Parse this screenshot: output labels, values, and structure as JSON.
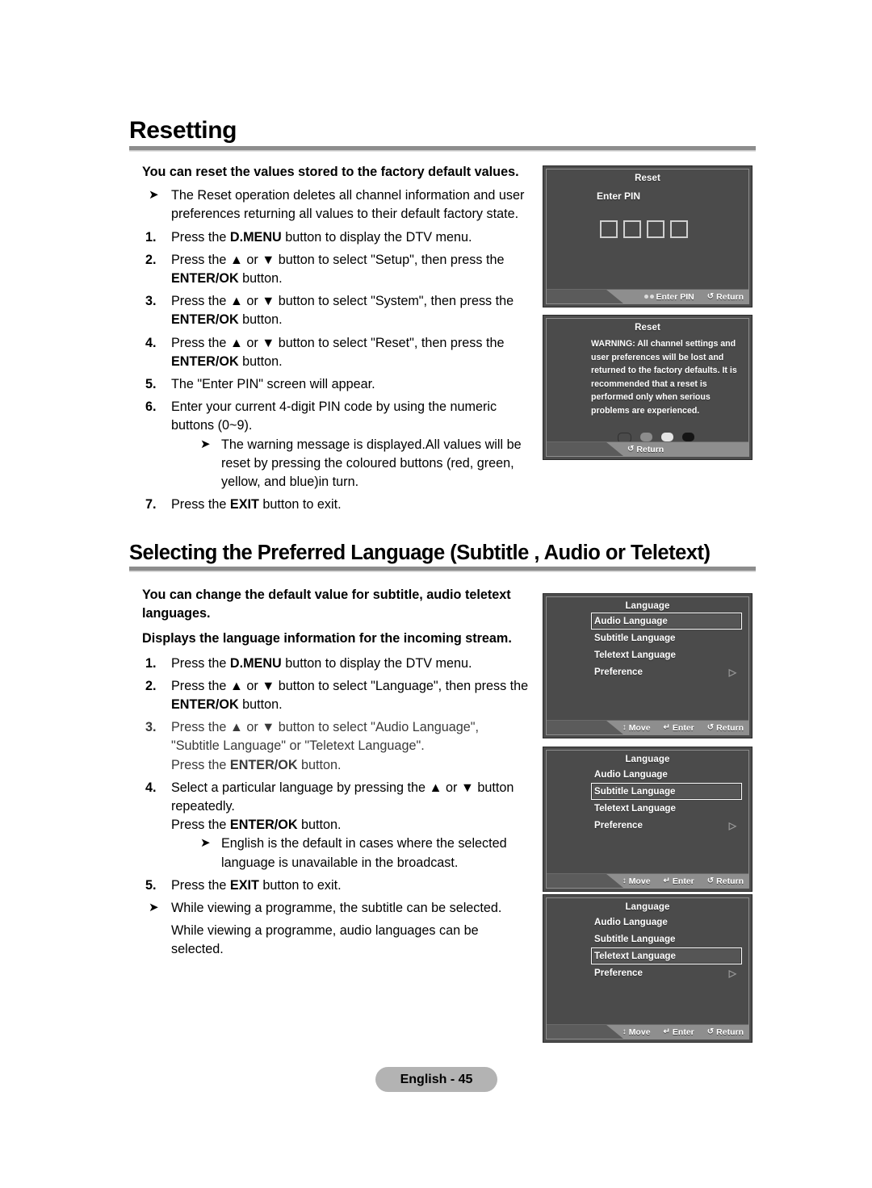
{
  "page": {
    "footer_label": "English - 45"
  },
  "sections": [
    {
      "heading": "Resetting",
      "lead": "You can reset the values stored to the factory default values.",
      "note_top": "The Reset operation deletes all channel information and user preferences returning all values to their default factory state.",
      "steps": [
        {
          "num": "1.",
          "text_a": "Press the ",
          "bold_a": "D.MENU",
          "text_b": " button to display the DTV menu."
        },
        {
          "num": "2.",
          "text_a": "Press the ▲ or ▼ button to select \"Setup\", then press the ",
          "bold_a": "ENTER/OK",
          "text_b": " button."
        },
        {
          "num": "3.",
          "text_a": "Press the ▲ or ▼ button to select \"System\", then press the ",
          "bold_a": "ENTER/OK",
          "text_b": " button."
        },
        {
          "num": "4.",
          "text_a": "Press the ▲ or ▼ button to select \"Reset\", then press the ",
          "bold_a": "ENTER/OK",
          "text_b": " button."
        },
        {
          "num": "5.",
          "text_a": "The \"Enter PIN\" screen will appear.",
          "bold_a": "",
          "text_b": ""
        },
        {
          "num": "6.",
          "text_a": "Enter your current 4-digit PIN code by using the numeric buttons (0~9).",
          "bold_a": "",
          "text_b": ""
        },
        {
          "num": "7.",
          "text_a": "Press the ",
          "bold_a": "EXIT",
          "text_b": " button to exit."
        }
      ],
      "note_step6": "The warning message is displayed.All values will be reset by pressing the coloured buttons (red, green, yellow, and blue)in turn."
    },
    {
      "heading": "Selecting the Preferred Language (Subtitle , Audio or Teletext)",
      "lead": "You can change the default value for subtitle, audio teletext languages.",
      "lead2": "Displays the language information for the incoming stream.",
      "steps": [
        {
          "num": "1.",
          "text_a": "Press the ",
          "bold_a": "D.MENU",
          "text_b": " button to display the DTV menu."
        },
        {
          "num": "2.",
          "text_a": "Press the ▲ or ▼ button to select \"Language\", then press the ",
          "bold_a": "ENTER/OK",
          "text_b": " button."
        },
        {
          "num": "3.",
          "text_a": "Press the ▲ or ▼ button to select \"Audio Language\", \"Subtitle Language\" or \"Teletext Language\".",
          "sub_a": "Press the ",
          "sub_bold": "ENTER/OK",
          "sub_b": " button."
        },
        {
          "num": "4.",
          "text_a": "Select a particular language by pressing the ▲ or ▼ button repeatedly.",
          "sub_a": "Press the ",
          "sub_bold": "ENTER/OK",
          "sub_b": " button."
        },
        {
          "num": "5.",
          "text_a": "Press the ",
          "bold_a": "EXIT",
          "text_b": " button to exit."
        }
      ],
      "note_step4": "English is the default in cases where the selected language is unavailable in the broadcast.",
      "note_bottom_1": "While viewing a programme, the subtitle can be selected.",
      "note_bottom_2": "While viewing a programme, audio languages can be selected."
    }
  ],
  "screens": {
    "pin": {
      "title": "Reset",
      "label": "Enter PIN",
      "box_count": 4,
      "hints": [
        {
          "glyph": "dots",
          "label": "Enter PIN"
        },
        {
          "glyph": "↺",
          "label": "Return"
        }
      ]
    },
    "warning": {
      "title": "Reset",
      "message": "WARNING: All channel settings and user preferences will be lost and returned to the factory defaults. It is recommended that a reset is performed only when serious problems are experienced.",
      "colour_buttons": [
        {
          "name": "red-button",
          "fill": "#4b4b4b",
          "border": "#2f2f2f"
        },
        {
          "name": "green-button",
          "fill": "#8c8c8c",
          "border": "#7a7a7a"
        },
        {
          "name": "yellow-button",
          "fill": "#e6e6e6",
          "border": "#cfcfcf"
        },
        {
          "name": "blue-button",
          "fill": "#151515",
          "border": "#000000"
        }
      ],
      "hints": [
        {
          "glyph": "↺",
          "label": "Return"
        }
      ]
    },
    "language_menu": {
      "title": "Language",
      "items": [
        {
          "label": "Audio Language",
          "arrow": ""
        },
        {
          "label": "Subtitle Language",
          "arrow": ""
        },
        {
          "label": "Teletext Language",
          "arrow": ""
        },
        {
          "label": "Preference",
          "arrow": "▷"
        }
      ],
      "hints": [
        {
          "glyph": "↕",
          "label": "Move"
        },
        {
          "glyph": "↵",
          "label": "Enter"
        },
        {
          "glyph": "↺",
          "label": "Return"
        }
      ],
      "selected_indices": [
        0,
        1,
        2
      ]
    }
  }
}
